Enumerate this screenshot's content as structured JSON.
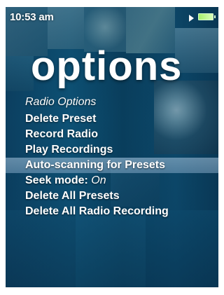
{
  "status_bar": {
    "time": "10:53 am",
    "play_state_icon": "play-icon",
    "battery_icon": "battery-icon"
  },
  "page": {
    "title": "options"
  },
  "menu": {
    "header": "Radio Options",
    "items": [
      {
        "label": "Delete Preset",
        "value": ""
      },
      {
        "label": "Record Radio",
        "value": ""
      },
      {
        "label": "Play Recordings",
        "value": ""
      },
      {
        "label": "Auto-scanning for Presets",
        "value": "",
        "selected": true
      },
      {
        "label": "Seek mode: ",
        "value": "On"
      },
      {
        "label": "Delete All Presets",
        "value": ""
      },
      {
        "label": "Delete All Radio Recording",
        "value": ""
      }
    ]
  },
  "colors": {
    "background": "#0d4568",
    "text": "#ffffff",
    "selection": "#9bb8d2",
    "battery": "#a7f06c"
  }
}
